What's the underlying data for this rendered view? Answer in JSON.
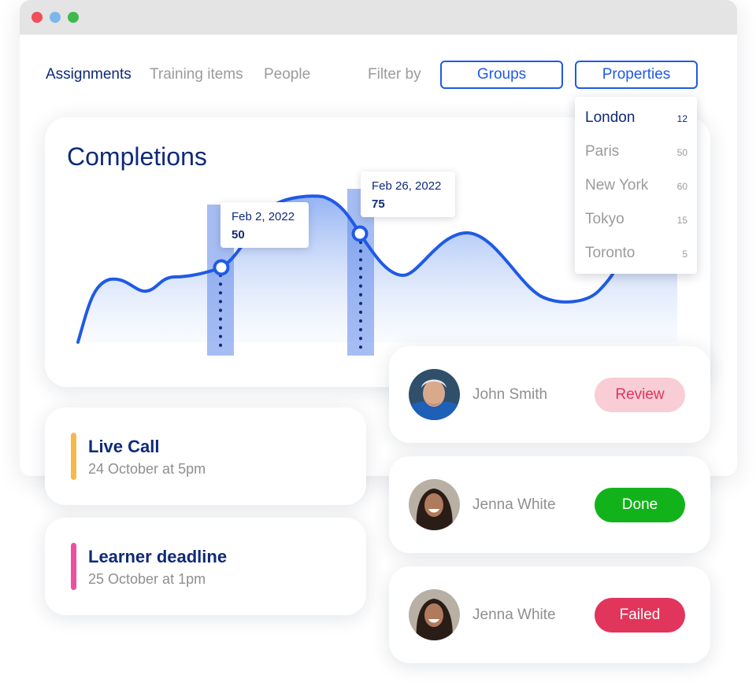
{
  "tabs": [
    {
      "label": "Assignments",
      "active": true
    },
    {
      "label": "Training items",
      "active": false
    },
    {
      "label": "People",
      "active": false
    }
  ],
  "filter": {
    "label": "Filter by",
    "groups_label": "Groups",
    "properties_label": "Properties"
  },
  "properties_dropdown": [
    {
      "name": "London",
      "count": "12",
      "selected": true
    },
    {
      "name": "Paris",
      "count": "50",
      "selected": false
    },
    {
      "name": "New York",
      "count": "60",
      "selected": false
    },
    {
      "name": "Tokyo",
      "count": "15",
      "selected": false
    },
    {
      "name": "Toronto",
      "count": "5",
      "selected": false
    }
  ],
  "completions": {
    "title": "Completions",
    "tooltips": [
      {
        "date": "Feb 2, 2022",
        "value": "50"
      },
      {
        "date": "Feb 26, 2022",
        "value": "75"
      }
    ]
  },
  "events": [
    {
      "title": "Live Call",
      "subtitle": "24 October at 5pm",
      "color": "#f7b84b"
    },
    {
      "title": "Learner deadline",
      "subtitle": "25 October at 1pm",
      "color": "#ef4fa0"
    }
  ],
  "people": [
    {
      "name": "John Smith",
      "status": "Review",
      "status_bg": "#f9cdd5",
      "status_fg": "#e2355b",
      "avatar": "older-man-avatar"
    },
    {
      "name": "Jenna White",
      "status": "Done",
      "status_bg": "#12b31a",
      "status_fg": "#ffffff",
      "avatar": "smiling-woman-avatar"
    },
    {
      "name": "Jenna White",
      "status": "Failed",
      "status_bg": "#e2355b",
      "status_fg": "#ffffff",
      "avatar": "smiling-woman-avatar"
    }
  ],
  "colors": {
    "navy": "#0f2a77",
    "accent_blue": "#1f5ae6",
    "muted": "#9b9b9b"
  }
}
